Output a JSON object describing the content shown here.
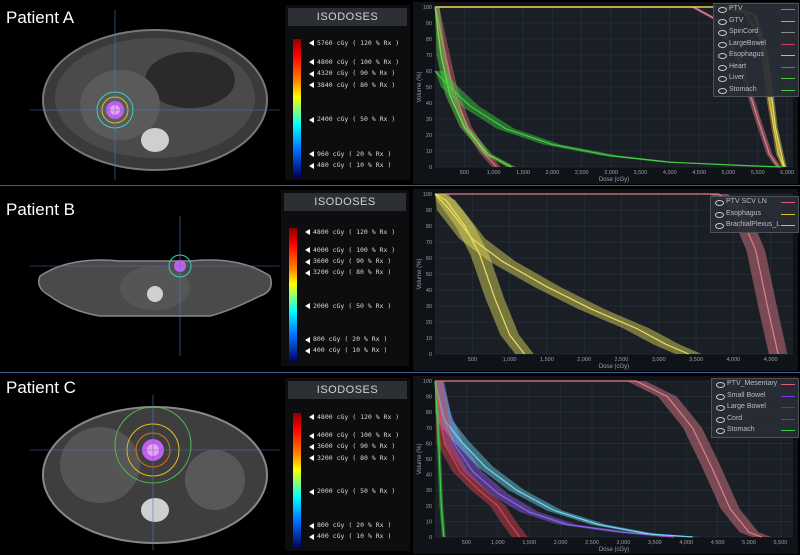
{
  "isodose_title": "ISODOSES",
  "patients": [
    {
      "label": "Patient A",
      "isodoses": [
        {
          "dose": "5760",
          "pct": "120",
          "level": 1.2
        },
        {
          "dose": "4800",
          "pct": "100",
          "level": 1.0
        },
        {
          "dose": "4320",
          "pct": "90",
          "level": 0.9
        },
        {
          "dose": "3840",
          "pct": "80",
          "level": 0.8
        },
        {
          "dose": "2400",
          "pct": "50",
          "level": 0.5
        },
        {
          "dose": "960",
          "pct": "20",
          "level": 0.2
        },
        {
          "dose": "480",
          "pct": "10",
          "level": 0.1
        }
      ],
      "legend": [
        {
          "name": "PTV",
          "color": "#e05a7a"
        },
        {
          "name": "GTV",
          "color": "#f0a020"
        },
        {
          "name": "SpinCord",
          "color": "#8a8a8a"
        },
        {
          "name": "LargeBowel",
          "color": "#d04060"
        },
        {
          "name": "Esophagus",
          "color": "#e0c020"
        },
        {
          "name": "Heart",
          "color": "#e04050"
        },
        {
          "name": "Liver",
          "color": "#50c040"
        },
        {
          "name": "Stomach",
          "color": "#30d040"
        }
      ]
    },
    {
      "label": "Patient B",
      "isodoses": [
        {
          "dose": "4800",
          "pct": "120",
          "level": 1.2
        },
        {
          "dose": "4000",
          "pct": "100",
          "level": 1.0
        },
        {
          "dose": "3600",
          "pct": "90",
          "level": 0.9
        },
        {
          "dose": "3200",
          "pct": "80",
          "level": 0.8
        },
        {
          "dose": "2000",
          "pct": "50",
          "level": 0.5
        },
        {
          "dose": "800",
          "pct": "20",
          "level": 0.2
        },
        {
          "dose": "400",
          "pct": "10",
          "level": 0.1
        }
      ],
      "legend": [
        {
          "name": "PTV SCV LN",
          "color": "#e05a7a"
        },
        {
          "name": "Esophagus",
          "color": "#e0c020"
        },
        {
          "name": "BrachialPlexus_L",
          "color": "#e0c020"
        }
      ]
    },
    {
      "label": "Patient C",
      "isodoses": [
        {
          "dose": "4800",
          "pct": "120",
          "level": 1.2
        },
        {
          "dose": "4000",
          "pct": "100",
          "level": 1.0
        },
        {
          "dose": "3600",
          "pct": "90",
          "level": 0.9
        },
        {
          "dose": "3200",
          "pct": "80",
          "level": 0.8
        },
        {
          "dose": "2000",
          "pct": "50",
          "level": 0.5
        },
        {
          "dose": "800",
          "pct": "20",
          "level": 0.2
        },
        {
          "dose": "400",
          "pct": "10",
          "level": 0.1
        }
      ],
      "legend": [
        {
          "name": "PTV_Mesentary",
          "color": "#e05a7a"
        },
        {
          "name": "Small Bowel",
          "color": "#7a3cf0"
        },
        {
          "name": "Large Bowel",
          "color": "#3a3ad0"
        },
        {
          "name": "Cord",
          "color": "#d02020"
        },
        {
          "name": "Stomach",
          "color": "#30d040"
        }
      ]
    }
  ],
  "chart_data": [
    {
      "type": "line",
      "title": "",
      "xlabel": "Dose (cGy)",
      "ylabel": "Volume (%)",
      "xlim": [
        0,
        6100
      ],
      "ylim": [
        0,
        100
      ],
      "xticks": [
        500,
        1000,
        1500,
        2000,
        2500,
        3000,
        3500,
        4000,
        4500,
        5000,
        5500,
        6000
      ],
      "xtick_labels": [
        "500",
        "1,000",
        "1,500",
        "2,000",
        "2,500",
        "3,000",
        "3,500",
        "4,000",
        "4,500",
        "5,000",
        "5,500",
        "6,000"
      ],
      "yticks": [
        0,
        10,
        20,
        30,
        40,
        50,
        60,
        70,
        80,
        90,
        100
      ],
      "grid": true,
      "legend_position": "top-right",
      "series": [
        {
          "name": "PTV",
          "color": "#e87c8c",
          "band": 100,
          "points": [
            [
              0,
              100
            ],
            [
              4400,
              100
            ],
            [
              4800,
              92
            ],
            [
              5200,
              65
            ],
            [
              5500,
              30
            ],
            [
              5700,
              8
            ],
            [
              5850,
              0
            ]
          ]
        },
        {
          "name": "GTV",
          "color": "#e8c040",
          "band": 80,
          "points": [
            [
              0,
              100
            ],
            [
              4900,
              100
            ],
            [
              5300,
              96
            ],
            [
              5550,
              80
            ],
            [
              5700,
              40
            ],
            [
              5850,
              8
            ],
            [
              5950,
              0
            ]
          ]
        },
        {
          "name": "Esophagus",
          "color": "#e8e060",
          "band": 80,
          "points": [
            [
              0,
              100
            ],
            [
              5100,
              100
            ],
            [
              5450,
              95
            ],
            [
              5650,
              70
            ],
            [
              5800,
              25
            ],
            [
              5950,
              0
            ]
          ]
        },
        {
          "name": "Heart",
          "color": "#e06a7a",
          "band": 150,
          "points": [
            [
              0,
              100
            ],
            [
              120,
              80
            ],
            [
              300,
              50
            ],
            [
              550,
              25
            ],
            [
              850,
              8
            ],
            [
              1050,
              0
            ]
          ]
        },
        {
          "name": "Liver",
          "color": "#70e050",
          "band": 150,
          "points": [
            [
              0,
              100
            ],
            [
              100,
              70
            ],
            [
              250,
              45
            ],
            [
              500,
              25
            ],
            [
              900,
              8
            ],
            [
              1300,
              0
            ]
          ]
        },
        {
          "name": "Stomach",
          "color": "#40d040",
          "band": 300,
          "points": [
            [
              0,
              60
            ],
            [
              250,
              50
            ],
            [
              600,
              38
            ],
            [
              1200,
              24
            ],
            [
              2000,
              14
            ],
            [
              3000,
              7
            ],
            [
              4000,
              3
            ],
            [
              5200,
              1
            ],
            [
              5900,
              0
            ]
          ]
        }
      ]
    },
    {
      "type": "line",
      "title": "",
      "xlabel": "Dose (cGy)",
      "ylabel": "Volume (%)",
      "xlim": [
        0,
        4800
      ],
      "ylim": [
        0,
        100
      ],
      "xticks": [
        500,
        1000,
        1500,
        2000,
        2500,
        3000,
        3500,
        4000,
        4500
      ],
      "xtick_labels": [
        "500",
        "1,000",
        "1,500",
        "2,000",
        "2,500",
        "3,000",
        "3,500",
        "4,000",
        "4,500"
      ],
      "yticks": [
        0,
        10,
        20,
        30,
        40,
        50,
        60,
        70,
        80,
        90,
        100
      ],
      "grid": true,
      "legend_position": "top-right",
      "series": [
        {
          "name": "PTV SCV LN",
          "color": "#e87c8c",
          "band": 250,
          "points": [
            [
              0,
              100
            ],
            [
              3800,
              100
            ],
            [
              4050,
              92
            ],
            [
              4300,
              65
            ],
            [
              4480,
              25
            ],
            [
              4600,
              0
            ]
          ]
        },
        {
          "name": "Esophagus",
          "color": "#e8e060",
          "band": 250,
          "points": [
            [
              0,
              100
            ],
            [
              150,
              96
            ],
            [
              400,
              80
            ],
            [
              600,
              62
            ],
            [
              800,
              35
            ],
            [
              1000,
              12
            ],
            [
              1200,
              0
            ]
          ]
        },
        {
          "name": "BrachialPlexus_L",
          "color": "#e8e060",
          "band": 350,
          "points": [
            [
              0,
              100
            ],
            [
              200,
              90
            ],
            [
              500,
              72
            ],
            [
              900,
              58
            ],
            [
              1500,
              42
            ],
            [
              2100,
              28
            ],
            [
              2700,
              16
            ],
            [
              3100,
              6
            ],
            [
              3400,
              0
            ]
          ]
        }
      ]
    },
    {
      "type": "line",
      "title": "",
      "xlabel": "Dose (cGy)",
      "ylabel": "Volume (%)",
      "xlim": [
        0,
        5700
      ],
      "ylim": [
        0,
        100
      ],
      "xticks": [
        500,
        1000,
        1500,
        2000,
        2500,
        3000,
        3500,
        4000,
        4500,
        5000,
        5500
      ],
      "xtick_labels": [
        "500",
        "1,000",
        "1,500",
        "2,000",
        "2,500",
        "3,000",
        "3,500",
        "4,000",
        "4,500",
        "5,000",
        "5,500"
      ],
      "yticks": [
        0,
        10,
        20,
        30,
        40,
        50,
        60,
        70,
        80,
        90,
        100
      ],
      "grid": true,
      "legend_position": "top-right",
      "series": [
        {
          "name": "PTV_Mesentary",
          "color": "#e87c8c",
          "band": 300,
          "points": [
            [
              0,
              100
            ],
            [
              3200,
              100
            ],
            [
              3700,
              90
            ],
            [
              4100,
              70
            ],
            [
              4400,
              45
            ],
            [
              4700,
              18
            ],
            [
              5000,
              3
            ],
            [
              5200,
              0
            ]
          ]
        },
        {
          "name": "Small Bowel",
          "color": "#9060f0",
          "band": 300,
          "points": [
            [
              0,
              100
            ],
            [
              100,
              80
            ],
            [
              300,
              60
            ],
            [
              600,
              42
            ],
            [
              1000,
              28
            ],
            [
              1500,
              16
            ],
            [
              2100,
              8
            ],
            [
              3000,
              3
            ],
            [
              3800,
              0
            ]
          ]
        },
        {
          "name": "Large Bowel",
          "color": "#70d8f0",
          "band": 250,
          "points": [
            [
              0,
              100
            ],
            [
              150,
              75
            ],
            [
              400,
              62
            ],
            [
              800,
              45
            ],
            [
              1300,
              30
            ],
            [
              1900,
              17
            ],
            [
              2600,
              8
            ],
            [
              3400,
              2
            ],
            [
              4100,
              0
            ]
          ]
        },
        {
          "name": "Cord",
          "color": "#e04050",
          "band": 250,
          "points": [
            [
              0,
              100
            ],
            [
              150,
              60
            ],
            [
              400,
              42
            ],
            [
              700,
              30
            ],
            [
              1000,
              20
            ],
            [
              1200,
              8
            ],
            [
              1350,
              0
            ]
          ]
        },
        {
          "name": "Stomach",
          "color": "#40d040",
          "band": 60,
          "points": [
            [
              0,
              100
            ],
            [
              60,
              60
            ],
            [
              100,
              20
            ],
            [
              140,
              0
            ]
          ]
        }
      ]
    }
  ]
}
